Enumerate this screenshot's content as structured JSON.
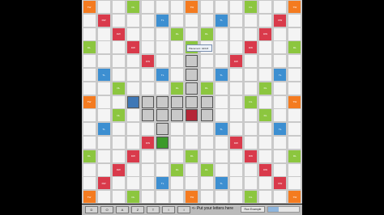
{
  "board": {
    "premium_labels": {
      "tw": "TW",
      "dw": "DW",
      "tl": "TL",
      "dl": "DL"
    },
    "premium_colors": {
      "tw": "#f47b20",
      "dw": "#d93a4b",
      "tl": "#3d8fd1",
      "dl": "#8cc63f"
    },
    "placed_tiles": [
      {
        "row": 4,
        "col": 7,
        "letter": "",
        "color": "gray"
      },
      {
        "row": 5,
        "col": 7,
        "letter": "",
        "color": "gray"
      },
      {
        "row": 6,
        "col": 7,
        "letter": "",
        "color": "gray"
      },
      {
        "row": 7,
        "col": 3,
        "letter": "",
        "color": "blue"
      },
      {
        "row": 7,
        "col": 4,
        "letter": "",
        "color": "gray"
      },
      {
        "row": 7,
        "col": 5,
        "letter": "",
        "color": "gray"
      },
      {
        "row": 7,
        "col": 6,
        "letter": "",
        "color": "gray"
      },
      {
        "row": 7,
        "col": 7,
        "letter": "",
        "color": "gray"
      },
      {
        "row": 7,
        "col": 8,
        "letter": "",
        "color": "gray"
      },
      {
        "row": 8,
        "col": 4,
        "letter": "",
        "color": "gray"
      },
      {
        "row": 8,
        "col": 5,
        "letter": "",
        "color": "gray"
      },
      {
        "row": 8,
        "col": 6,
        "letter": "",
        "color": "gray"
      },
      {
        "row": 8,
        "col": 7,
        "letter": "",
        "color": "red"
      },
      {
        "row": 8,
        "col": 8,
        "letter": "",
        "color": "gray"
      },
      {
        "row": 9,
        "col": 5,
        "letter": "",
        "color": "gray"
      },
      {
        "row": 10,
        "col": 5,
        "letter": "",
        "color": "green"
      }
    ]
  },
  "tooltip": {
    "text": "Placement: 42/0.8"
  },
  "rack": {
    "tiles": [
      "D",
      "O",
      "A",
      "Z",
      "T",
      "I",
      "I"
    ],
    "hint": "<- Put your letters here",
    "run_button": "Run Example",
    "progress": 0.35
  }
}
